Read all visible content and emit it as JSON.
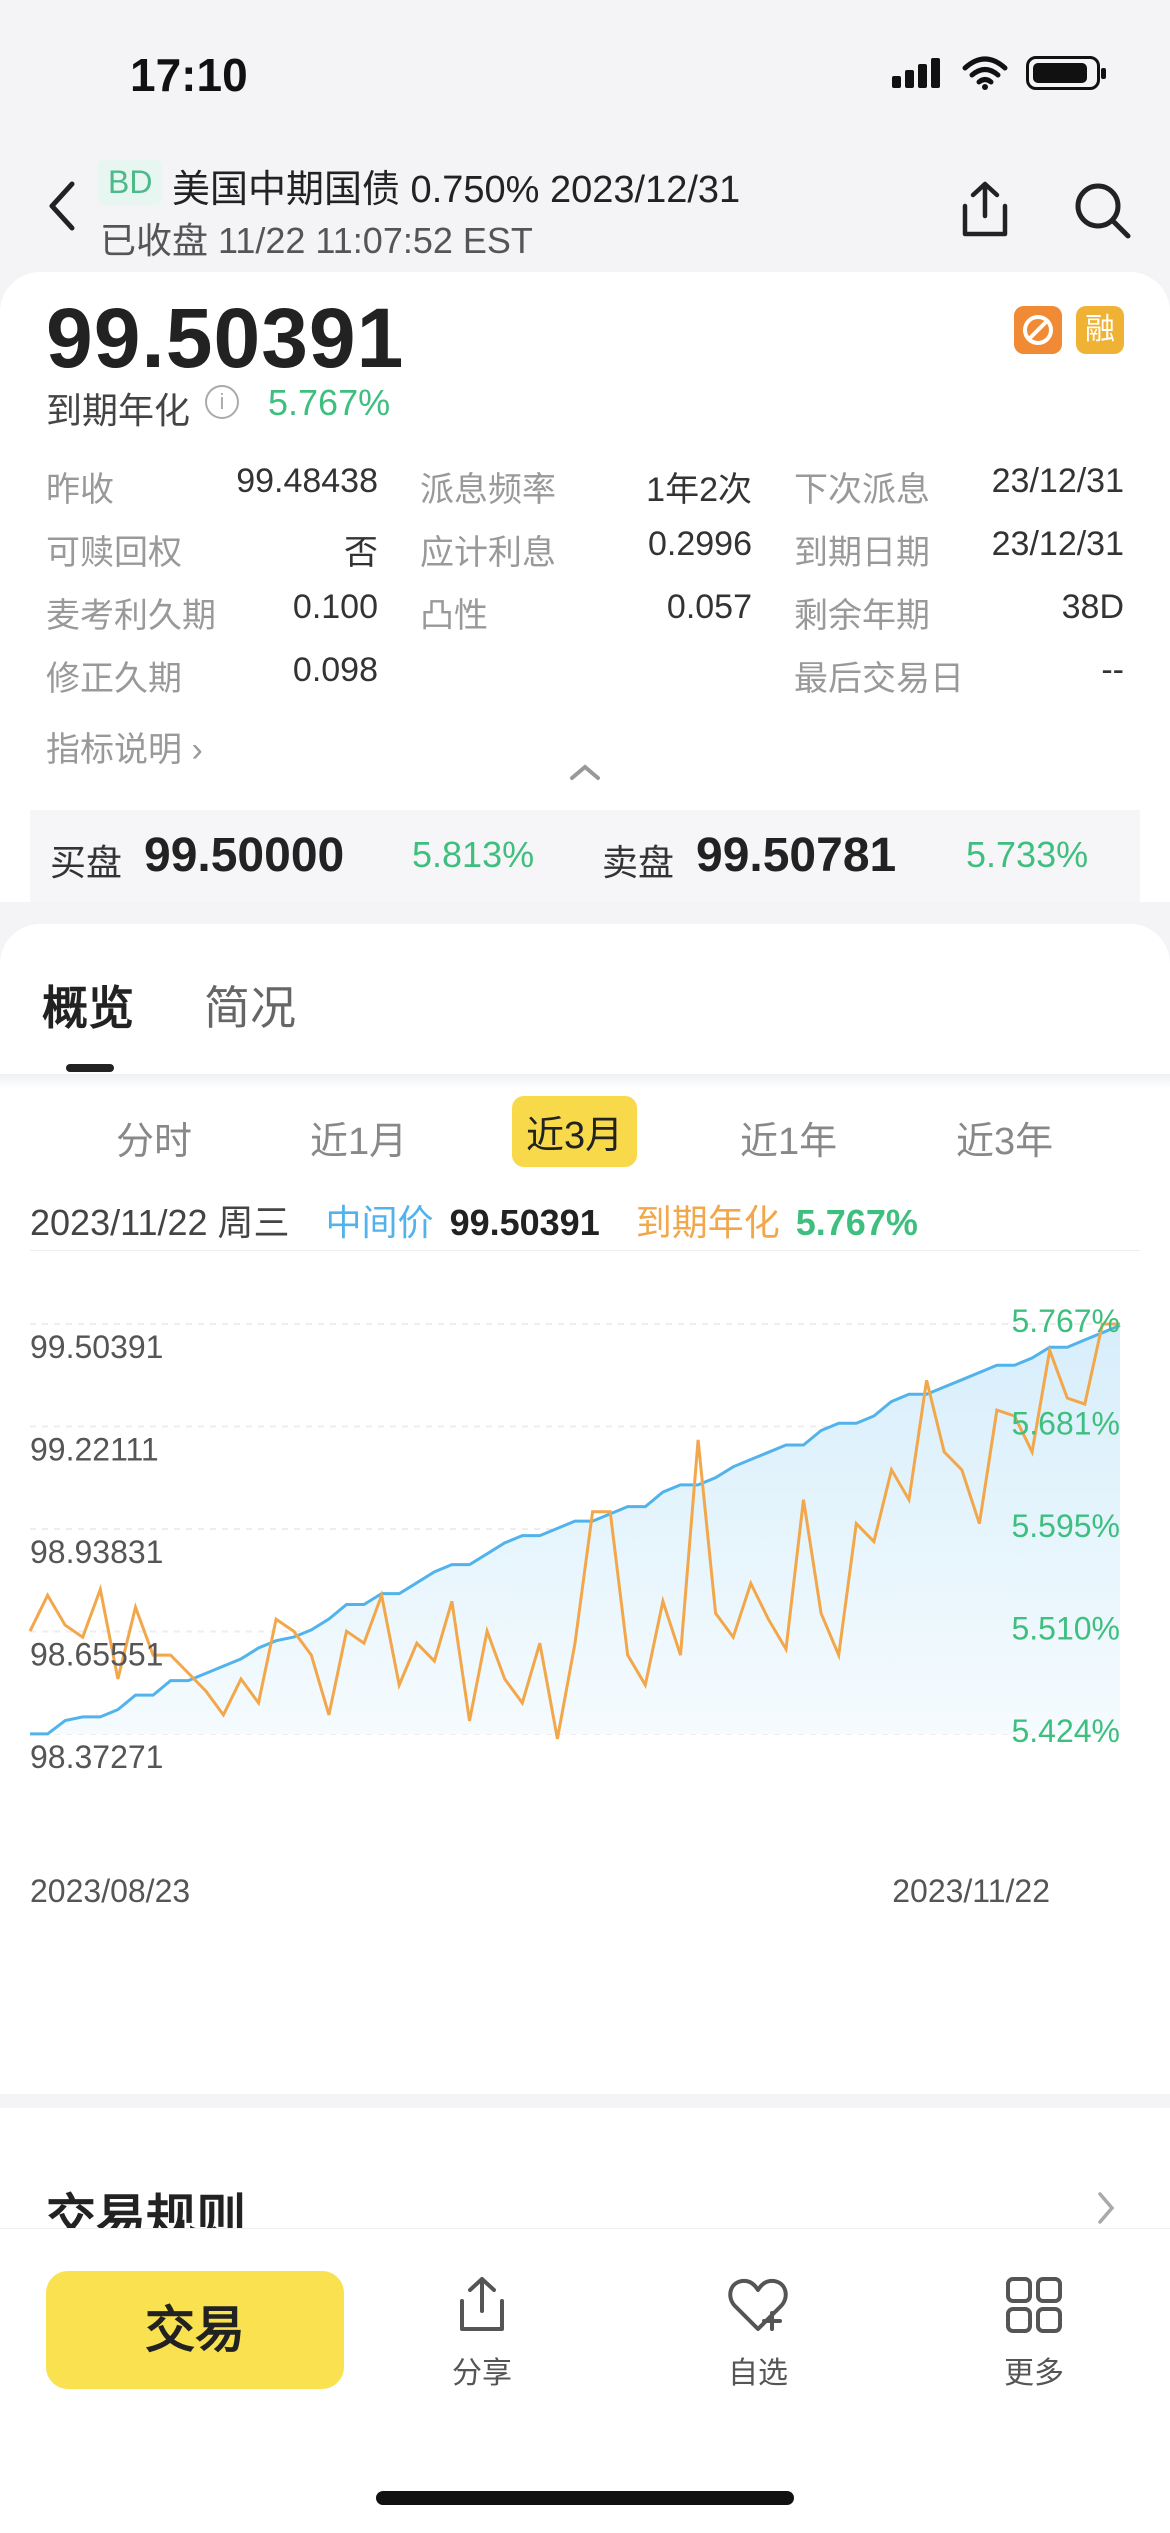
{
  "status_bar": {
    "time": "17:10"
  },
  "header": {
    "badge": "BD",
    "title": "美国中期国债 0.750% 2023/12/31",
    "subtitle": "已收盘 11/22 11:07:52 EST"
  },
  "summary": {
    "price": "99.50391",
    "ytm_label": "到期年化",
    "ytm_value": "5.767%",
    "tag_rong": "融"
  },
  "metrics": [
    [
      {
        "label": "昨收",
        "value": "99.48438"
      },
      {
        "label": "派息频率",
        "value": "1年2次"
      },
      {
        "label": "下次派息",
        "value": "23/12/31"
      }
    ],
    [
      {
        "label": "可赎回权",
        "value": "否"
      },
      {
        "label": "应计利息",
        "value": "0.2996"
      },
      {
        "label": "到期日期",
        "value": "23/12/31"
      }
    ],
    [
      {
        "label": "麦考利久期",
        "value": "0.100"
      },
      {
        "label": "凸性",
        "value": "0.057"
      },
      {
        "label": "剩余年期",
        "value": "38D"
      }
    ],
    [
      {
        "label": "修正久期",
        "value": "0.098"
      },
      {
        "label": "",
        "value": ""
      },
      {
        "label": "最后交易日",
        "value": "--"
      }
    ]
  ],
  "metrics_link": "指标说明",
  "bid_ask": {
    "bid_label": "买盘",
    "bid_price": "99.50000",
    "bid_pct": "5.813%",
    "ask_label": "卖盘",
    "ask_price": "99.50781",
    "ask_pct": "5.733%"
  },
  "tabs": [
    "概览",
    "简况"
  ],
  "ranges": [
    "分时",
    "近1月",
    "近3月",
    "近1年",
    "近3年"
  ],
  "active_range": "近3月",
  "quote": {
    "date": "2023/11/22 周三",
    "mid_label": "中间价",
    "mid_value": "99.50391",
    "ytm_label": "到期年化",
    "ytm_value": "5.767%"
  },
  "chart_data": {
    "type": "line",
    "x_start": "2023/08/23",
    "x_end": "2023/11/22",
    "y_left_ticks": [
      "99.50391",
      "99.22111",
      "98.93831",
      "98.65551",
      "98.37271"
    ],
    "y_right_ticks": [
      "5.767%",
      "5.681%",
      "5.595%",
      "5.510%",
      "5.424%"
    ],
    "y_left_range": [
      98.37271,
      99.50391
    ],
    "y_right_range": [
      5.424,
      5.767
    ],
    "series": [
      {
        "name": "中间价",
        "color": "#52b3ec",
        "values": [
          98.373,
          98.373,
          98.41,
          98.42,
          98.42,
          98.44,
          98.48,
          98.48,
          98.52,
          98.52,
          98.54,
          98.56,
          98.58,
          98.61,
          98.63,
          98.64,
          98.66,
          98.69,
          98.73,
          98.73,
          98.76,
          98.76,
          98.79,
          98.82,
          98.84,
          98.84,
          98.87,
          98.9,
          98.92,
          98.92,
          98.94,
          98.96,
          98.96,
          98.98,
          99.0,
          99.0,
          99.04,
          99.06,
          99.06,
          99.08,
          99.11,
          99.13,
          99.15,
          99.17,
          99.17,
          99.21,
          99.23,
          99.23,
          99.25,
          99.29,
          99.31,
          99.31,
          99.33,
          99.35,
          99.37,
          99.39,
          99.39,
          99.41,
          99.44,
          99.44,
          99.46,
          99.48,
          99.5
        ]
      },
      {
        "name": "到期年化",
        "color": "#f2a74a",
        "values": [
          5.51,
          5.54,
          5.515,
          5.505,
          5.545,
          5.47,
          5.53,
          5.49,
          5.49,
          5.475,
          5.46,
          5.44,
          5.47,
          5.45,
          5.52,
          5.51,
          5.49,
          5.44,
          5.51,
          5.5,
          5.54,
          5.465,
          5.5,
          5.485,
          5.535,
          5.435,
          5.51,
          5.47,
          5.45,
          5.5,
          5.42,
          5.5,
          5.61,
          5.61,
          5.49,
          5.465,
          5.535,
          5.49,
          5.67,
          5.525,
          5.505,
          5.55,
          5.52,
          5.495,
          5.62,
          5.525,
          5.49,
          5.6,
          5.585,
          5.645,
          5.62,
          5.72,
          5.66,
          5.645,
          5.6,
          5.695,
          5.69,
          5.66,
          5.745,
          5.705,
          5.7,
          5.767,
          5.767
        ]
      }
    ]
  },
  "section_rules": "交易规则",
  "bottom_bar": {
    "trade": "交易",
    "share": "分享",
    "watch": "自选",
    "more": "更多"
  }
}
